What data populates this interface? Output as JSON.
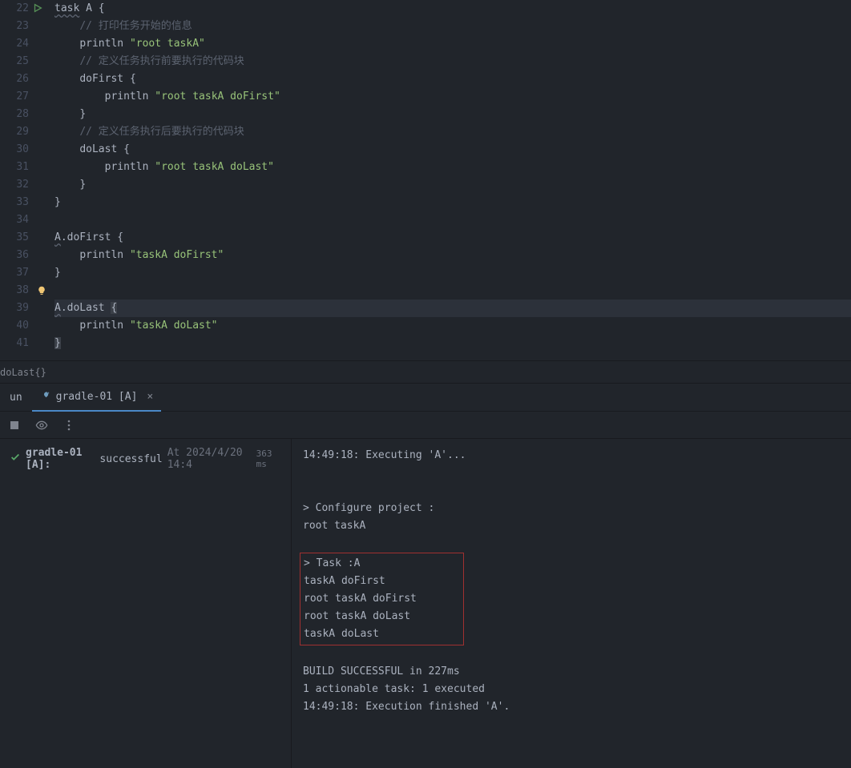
{
  "editor": {
    "lines": [
      {
        "n": "22",
        "type": "code",
        "run": true,
        "segs": [
          {
            "t": "task",
            "c": "underline"
          },
          {
            "t": " A "
          },
          {
            "t": "{",
            "c": "kw"
          }
        ]
      },
      {
        "n": "23",
        "type": "code",
        "segs": [
          {
            "t": "    "
          },
          {
            "t": "// 打印任务开始的信息",
            "c": "cmt"
          }
        ]
      },
      {
        "n": "24",
        "type": "code",
        "segs": [
          {
            "t": "    "
          },
          {
            "t": "println ",
            "c": "fn"
          },
          {
            "t": "\"root taskA\"",
            "c": "str"
          }
        ]
      },
      {
        "n": "25",
        "type": "code",
        "segs": [
          {
            "t": "    "
          },
          {
            "t": "// 定义任务执行前要执行的代码块",
            "c": "cmt"
          }
        ]
      },
      {
        "n": "26",
        "type": "code",
        "segs": [
          {
            "t": "    "
          },
          {
            "t": "doFirst ",
            "c": "fn"
          },
          {
            "t": "{",
            "c": "kw"
          }
        ]
      },
      {
        "n": "27",
        "type": "code",
        "segs": [
          {
            "t": "        "
          },
          {
            "t": "println ",
            "c": "fn"
          },
          {
            "t": "\"root taskA doFirst\"",
            "c": "str"
          }
        ]
      },
      {
        "n": "28",
        "type": "code",
        "segs": [
          {
            "t": "    "
          },
          {
            "t": "}",
            "c": "kw"
          }
        ]
      },
      {
        "n": "29",
        "type": "code",
        "segs": [
          {
            "t": "    "
          },
          {
            "t": "// 定义任务执行后要执行的代码块",
            "c": "cmt"
          }
        ]
      },
      {
        "n": "30",
        "type": "code",
        "segs": [
          {
            "t": "    "
          },
          {
            "t": "doLast ",
            "c": "fn"
          },
          {
            "t": "{",
            "c": "kw"
          }
        ]
      },
      {
        "n": "31",
        "type": "code",
        "segs": [
          {
            "t": "        "
          },
          {
            "t": "println ",
            "c": "fn"
          },
          {
            "t": "\"root taskA doLast\"",
            "c": "str"
          }
        ]
      },
      {
        "n": "32",
        "type": "code",
        "segs": [
          {
            "t": "    "
          },
          {
            "t": "}",
            "c": "kw"
          }
        ]
      },
      {
        "n": "33",
        "type": "code",
        "segs": [
          {
            "t": "}",
            "c": "kw"
          }
        ]
      },
      {
        "n": "34",
        "type": "code",
        "segs": [
          {
            "t": " "
          }
        ]
      },
      {
        "n": "35",
        "type": "code",
        "segs": [
          {
            "t": "A",
            "c": "underline"
          },
          {
            "t": ".doFirst ",
            "c": "fn"
          },
          {
            "t": "{",
            "c": "kw"
          }
        ]
      },
      {
        "n": "36",
        "type": "code",
        "segs": [
          {
            "t": "    "
          },
          {
            "t": "println ",
            "c": "fn"
          },
          {
            "t": "\"taskA doFirst\"",
            "c": "str"
          }
        ]
      },
      {
        "n": "37",
        "type": "code",
        "segs": [
          {
            "t": "}",
            "c": "kw"
          }
        ]
      },
      {
        "n": "38",
        "type": "code",
        "bulb": true,
        "segs": [
          {
            "t": " "
          }
        ]
      },
      {
        "n": "39",
        "type": "code",
        "hl": true,
        "segs": [
          {
            "t": "A",
            "c": "underline"
          },
          {
            "t": ".doLast ",
            "c": "fn"
          },
          {
            "t": "{",
            "c": "caret-brace"
          }
        ]
      },
      {
        "n": "40",
        "type": "code",
        "segs": [
          {
            "t": "    "
          },
          {
            "t": "println ",
            "c": "fn"
          },
          {
            "t": "\"taskA doLast\"",
            "c": "str"
          }
        ]
      },
      {
        "n": "41",
        "type": "code",
        "segs": [
          {
            "t": "}",
            "c": "caret-brace"
          }
        ]
      }
    ]
  },
  "breadcrumb": "doLast{}",
  "tabs": {
    "run_label": "un",
    "active": "gradle-01 [A]"
  },
  "status": {
    "name": "gradle-01 [A]:",
    "result": "successful",
    "at": "At 2024/4/20 14:4",
    "ms": "363 ms"
  },
  "console": {
    "l1": "14:49:18: Executing 'A'...",
    "l2": "",
    "l3": "",
    "l4": "> Configure project :",
    "l5": "root taskA",
    "l6": "",
    "box": "> Task :A\ntaskA doFirst\nroot taskA doFirst\nroot taskA doLast\ntaskA doLast",
    "l8": "",
    "l9": "BUILD SUCCESSFUL in 227ms",
    "l10": "1 actionable task: 1 executed",
    "l11": "14:49:18: Execution finished 'A'."
  }
}
